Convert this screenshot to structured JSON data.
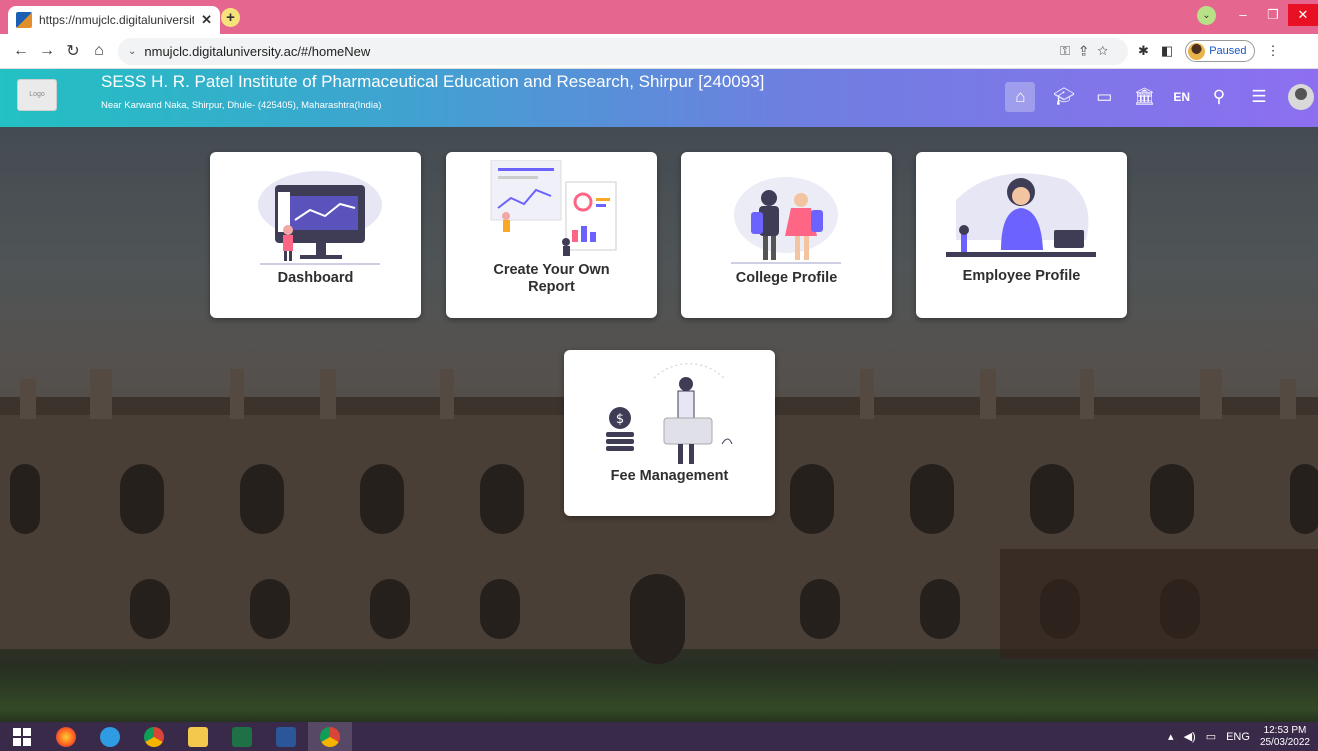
{
  "browser": {
    "tab_title": "https://nmujclc.digitaluniversity.a",
    "url": "nmujclc.digitaluniversity.ac/#/homeNew",
    "profile_status": "Paused"
  },
  "header": {
    "logo_text": "Logo",
    "institute_name": "SESS H. R. Patel Institute of Pharmaceutical Education and Research, Shirpur [240093]",
    "institute_address": "Near Karwand Naka, Shirpur, Dhule- (425405), Maharashtra(India)",
    "language": "EN",
    "icons": [
      "home-icon",
      "graduation-cap-icon",
      "screen-icon",
      "institution-icon",
      "search-icon",
      "menu-icon",
      "user-avatar"
    ]
  },
  "cards": [
    {
      "label": "Dashboard",
      "icon": "dashboard-illustration"
    },
    {
      "label": "Create Your Own Report",
      "icon": "report-illustration"
    },
    {
      "label": "College Profile",
      "icon": "students-illustration"
    },
    {
      "label": "Employee Profile",
      "icon": "employee-illustration"
    },
    {
      "label": "Fee Management",
      "icon": "fee-illustration"
    }
  ],
  "taskbar": {
    "language": "ENG",
    "time": "12:53 PM",
    "date": "25/03/2022"
  },
  "colors": {
    "tab_strip": "#e5668e",
    "header_start": "#22c1c3",
    "header_end": "#8d6ff0",
    "accent_purple": "#6c63ff"
  }
}
